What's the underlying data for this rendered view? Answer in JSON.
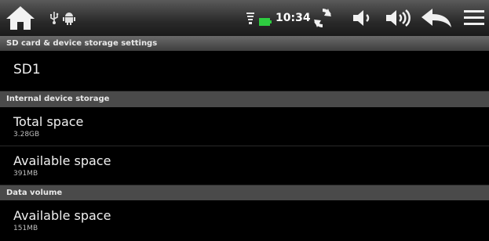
{
  "status_bar": {
    "time": "10:34",
    "icons": [
      "home-icon",
      "usb-icon",
      "android-debug-icon",
      "wifi-icon",
      "battery-icon",
      "refresh-icon",
      "volume-down-icon",
      "volume-up-icon",
      "back-icon",
      "menu-icon"
    ],
    "battery_color": "#2ecc40"
  },
  "settings": {
    "title": "SD card & device storage settings",
    "sd_item": "SD1",
    "internal_header": "Internal device storage",
    "total_space": {
      "label": "Total space",
      "value": "3.28GB"
    },
    "available_space": {
      "label": "Available space",
      "value": "391MB"
    },
    "data_header": "Data volume",
    "data_available": {
      "label": "Available space",
      "value": "151MB"
    }
  }
}
